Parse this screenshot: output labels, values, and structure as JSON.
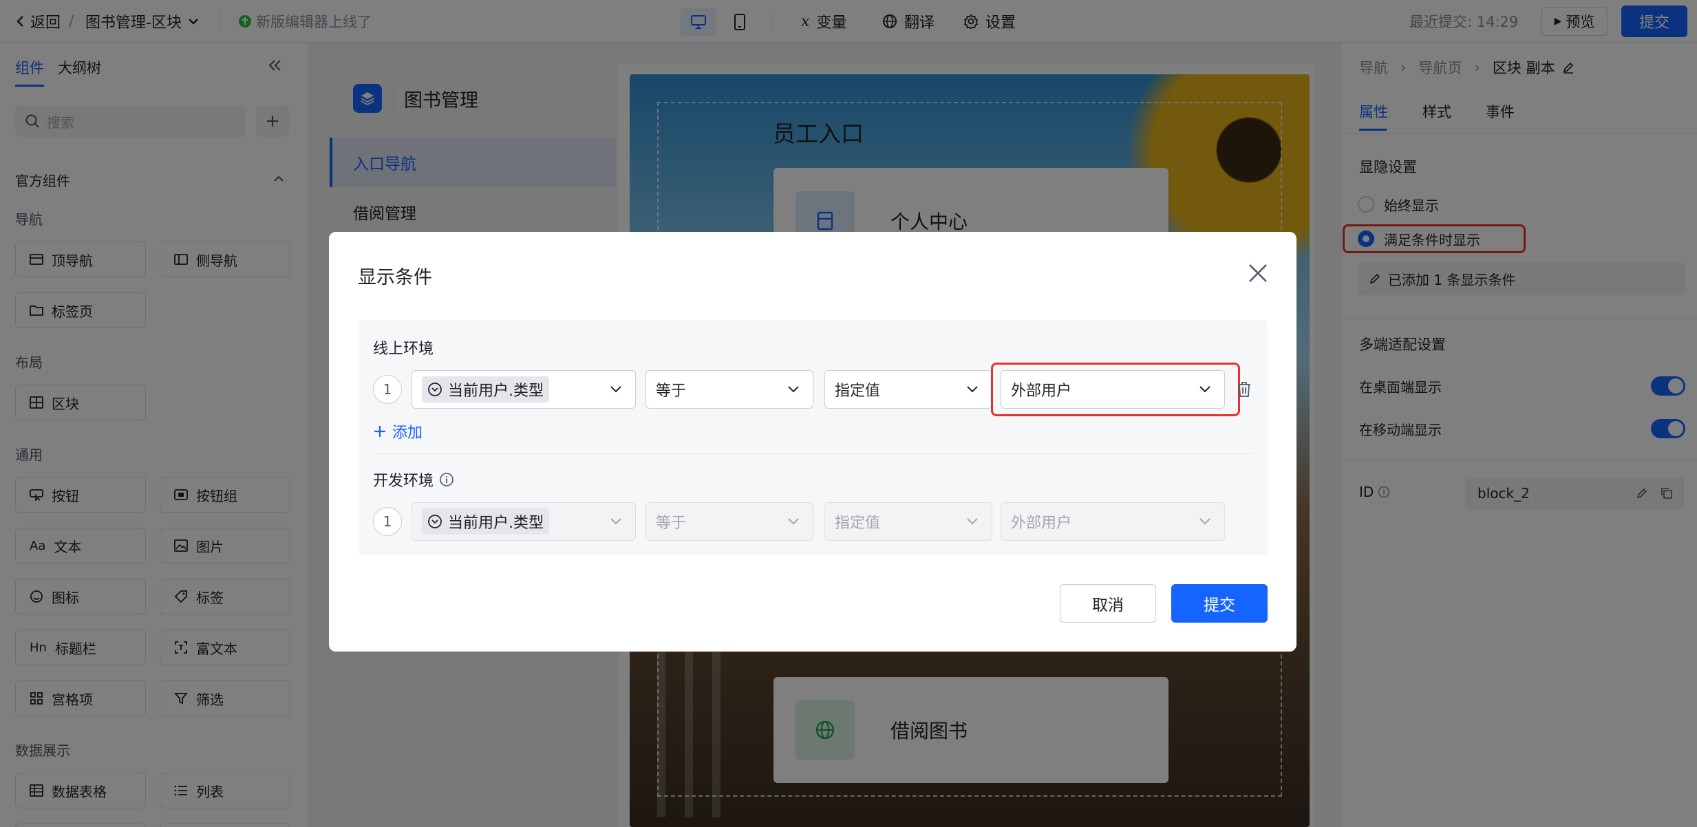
{
  "topbar": {
    "back_label": "返回",
    "breadcrumb_sep": "/",
    "app_name": "图书管理-区块",
    "notice": "新版编辑器上线了",
    "variable_label": "变量",
    "translate_label": "翻译",
    "settings_label": "设置",
    "last_submit": "最近提交: 14:29",
    "preview_label": "预览",
    "submit_label": "提交"
  },
  "left_panel": {
    "tabs": [
      "组件",
      "大纲树"
    ],
    "search_placeholder": "搜索",
    "section_title": "官方组件",
    "groups": {
      "nav": "导航",
      "layout": "布局",
      "common": "通用",
      "data": "数据展示"
    },
    "components": {
      "top_nav": "顶导航",
      "side_nav": "侧导航",
      "tab_page": "标签页",
      "block": "区块",
      "button": "按钮",
      "button_group": "按钮组",
      "text": "文本",
      "image": "图片",
      "icon": "图标",
      "tag": "标签",
      "title_bar": "标题栏",
      "rich_text": "富文本",
      "grid_item": "宫格项",
      "filter": "筛选",
      "data_table": "数据表格",
      "list": "列表"
    }
  },
  "canvas": {
    "app_title": "图书管理",
    "nav_items": [
      "入口导航",
      "借阅管理"
    ],
    "hero_title": "员工入口",
    "cards": [
      "个人中心",
      "借阅图书"
    ]
  },
  "right_panel": {
    "breadcrumb": [
      "导航",
      "导航页",
      "区块 副本"
    ],
    "breadcrumb_sep": "›",
    "tabs": [
      "属性",
      "样式",
      "事件"
    ],
    "visibility_title": "显隐设置",
    "always_show": "始终显示",
    "conditional_show": "满足条件时显示",
    "condition_summary": "已添加 1 条显示条件",
    "multi_device_title": "多端适配设置",
    "desktop_show": "在桌面端显示",
    "mobile_show": "在移动端显示",
    "id_label": "ID",
    "id_value": "block_2"
  },
  "modal": {
    "title": "显示条件",
    "online_env": "线上环境",
    "dev_env": "开发环境",
    "row_index": "1",
    "field_value": "当前用户.类型",
    "operator_value": "等于",
    "value_type": "指定值",
    "value": "外部用户",
    "add_label": "添加",
    "cancel_label": "取消",
    "submit_label": "提交"
  },
  "colors": {
    "primary": "#1664ff",
    "highlight": "#e8322f"
  }
}
